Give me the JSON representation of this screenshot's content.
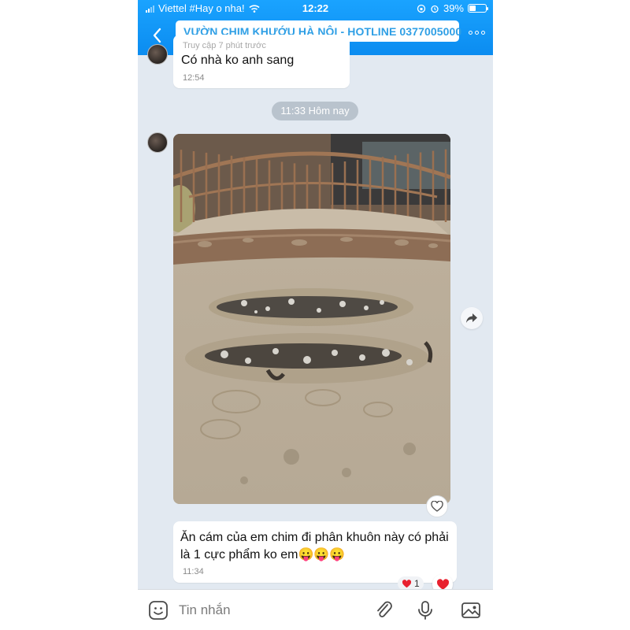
{
  "status": {
    "carrier": "Viettel #Hay o nha!",
    "time": "12:22",
    "battery": "39%",
    "battery_level": 0.39
  },
  "header": {
    "title": "VƯỜN CHIM KHƯỚU HÀ NỘI - HOTLINE 0377005000"
  },
  "messages": {
    "previous": {
      "subtitle": "Truy cập 7 phút trước",
      "text": "Có nhà ko anh sang",
      "time": "12:54"
    },
    "date_divider": "11:33 Hôm nay",
    "latest": {
      "text": "Ăn cám của em chim đi phân khuôn này có phải là 1 cực phẩm ko em😛😛😛",
      "time": "11:34",
      "reaction_count": "1"
    }
  },
  "composer": {
    "placeholder": "Tin nhắn"
  },
  "icons": {
    "back": "chevron-left-icon",
    "location": "location-pin-icon",
    "more": "more-dots-icon",
    "share": "share-forward-icon",
    "like": "heart-outline-icon",
    "reaction": "heart-icon",
    "sticker": "sticker-smile-icon",
    "attach": "paperclip-icon",
    "voice": "microphone-icon",
    "image": "image-icon"
  },
  "colors": {
    "header": "#1aa3ff",
    "title_text": "#2f9fe5",
    "chat_bg": "#e2e9f1",
    "reaction": "#e8212f"
  }
}
